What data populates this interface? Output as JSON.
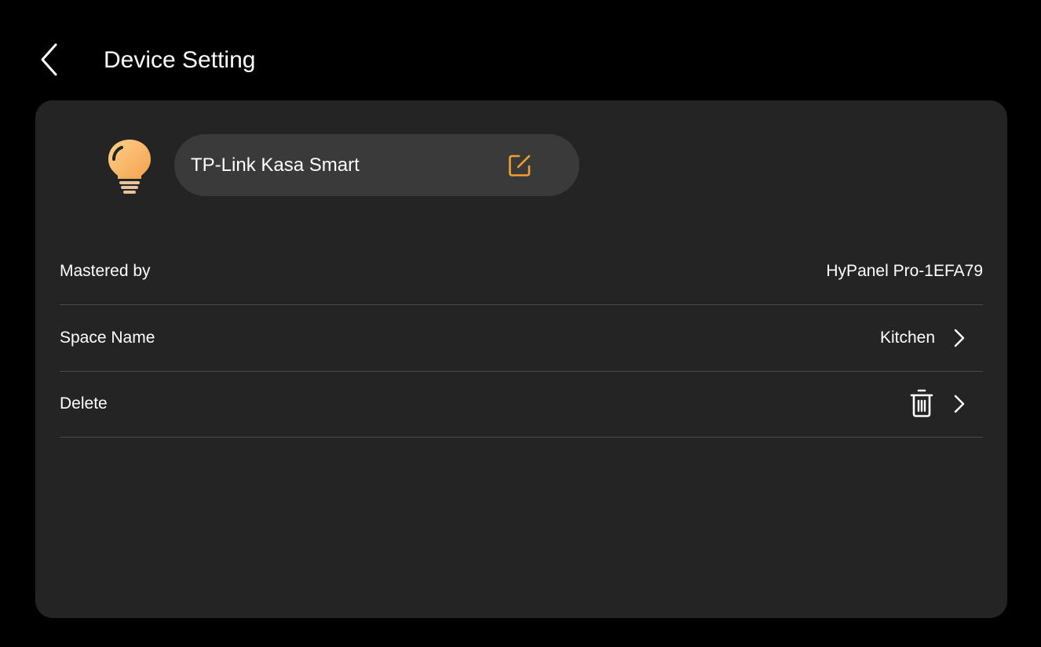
{
  "header": {
    "back_icon": "chevron-left-icon",
    "title": "Device Setting"
  },
  "device": {
    "icon": "lightbulb-icon",
    "name": "TP-Link Kasa Smart",
    "edit_icon": "edit-icon"
  },
  "settings": [
    {
      "label": "Mastered by",
      "value": "HyPanel Pro-1EFA79"
    },
    {
      "label": "Space Name",
      "value": "Kitchen",
      "trailing_icon": "chevron-right-icon"
    },
    {
      "label": "Delete",
      "icon": "trash-icon",
      "trailing_icon": "chevron-right-icon"
    }
  ],
  "colors": {
    "background": "#000000",
    "card": "#242424",
    "pill": "#3a3a3a",
    "accent": "#f0a030",
    "divider": "#4a4a4a",
    "text": "#ffffff"
  }
}
